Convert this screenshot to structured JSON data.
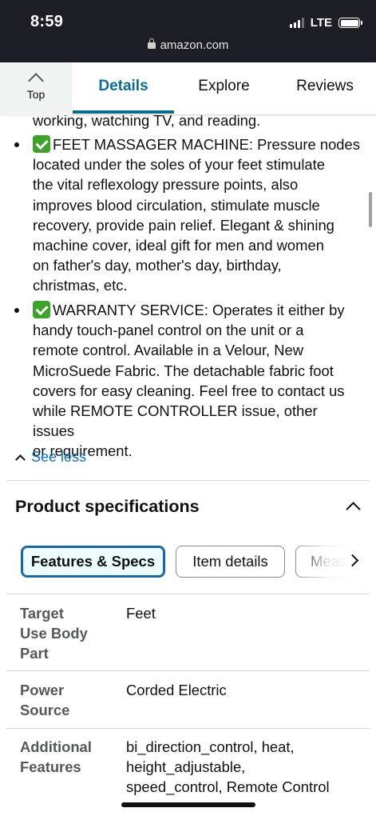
{
  "status_bar": {
    "time": "8:59",
    "network": "LTE",
    "url": "amazon.com"
  },
  "tabnav": {
    "top_label": "Top",
    "tabs": [
      {
        "label": "Details",
        "active": true
      },
      {
        "label": "Explore",
        "active": false
      },
      {
        "label": "Reviews",
        "active": false
      }
    ]
  },
  "description": {
    "intro_tail": "working, watching TV, and reading.",
    "bullets": [
      {
        "icon": "check-icon",
        "lines": [
          "FEET MASSAGER MACHINE: Pressure nodes",
          "located under the soles of your feet stimulate",
          "the vital reflexology pressure points, also",
          "improves blood circulation, stimulate muscle",
          "recovery, provide pain relief. Elegant & shining",
          "machine cover, ideal gift for men and women",
          "on father's day, mother's day, birthday,",
          "christmas, etc."
        ]
      },
      {
        "icon": "check-icon",
        "lines": [
          "WARRANTY SERVICE: Operates it either by",
          "handy touch-panel control on the unit or a",
          "remote control. Available in a Velour, New",
          "MicroSuede Fabric. The detachable fabric foot",
          "covers for easy cleaning. Feel free to contact us",
          "while REMOTE CONTROLLER issue, other issues",
          "or requirement."
        ]
      }
    ],
    "see_less": "See less"
  },
  "specifications": {
    "title": "Product specifications",
    "chips": [
      {
        "label": "Features & Specs",
        "selected": true
      },
      {
        "label": "Item details",
        "selected": false
      },
      {
        "label": "Measu",
        "selected": false
      }
    ],
    "rows": [
      {
        "key_lines": [
          "Target",
          "Use Body",
          "Part"
        ],
        "value_lines": [
          "Feet"
        ]
      },
      {
        "key_lines": [
          "Power",
          "Source"
        ],
        "value_lines": [
          "Corded Electric"
        ]
      },
      {
        "key_lines": [
          "Additional",
          "Features"
        ],
        "value_lines": [
          "bi_direction_control, heat,",
          "height_adjustable,",
          "speed_control, Remote Control"
        ]
      }
    ]
  },
  "colors": {
    "accent": "#0e6b8a",
    "link": "#146eb4",
    "check": "#3fa22b",
    "chip_selected_border": "#2162a1"
  }
}
